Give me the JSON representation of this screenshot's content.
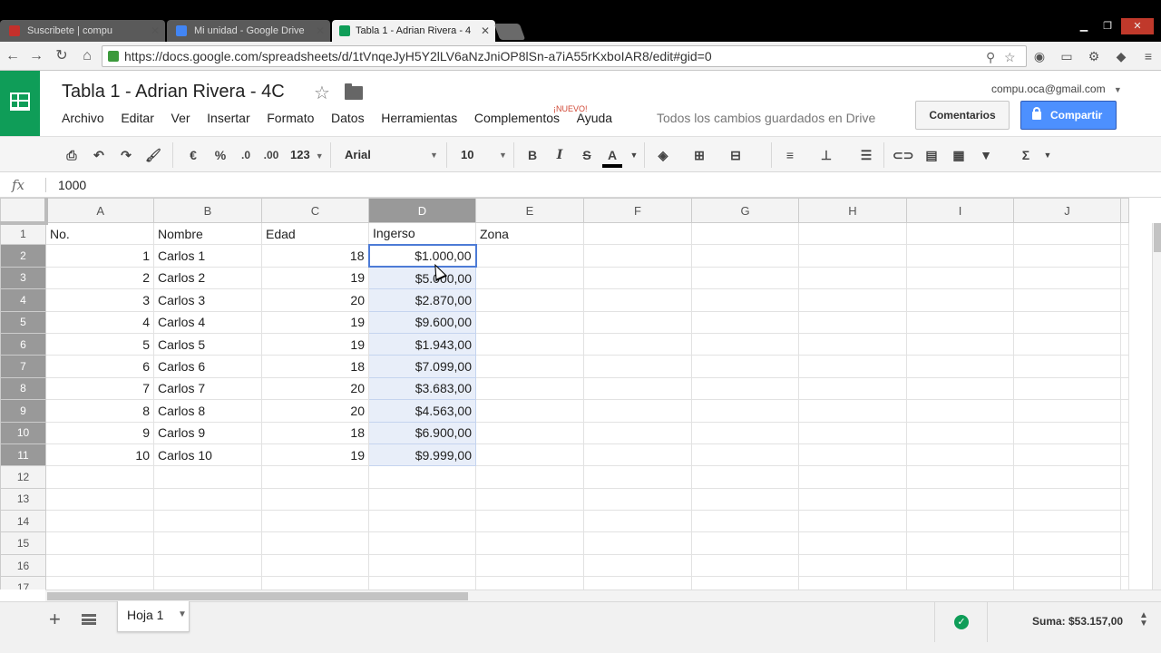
{
  "browser": {
    "tabs": [
      {
        "title": "Suscribete | compu",
        "active": false,
        "favicon_color": "#c4302b"
      },
      {
        "title": "Mi unidad - Google Drive",
        "active": false,
        "favicon_color": "#4285f4"
      },
      {
        "title": "Tabla 1 - Adrian Rivera - 4",
        "active": true,
        "favicon_color": "#0f9d58"
      }
    ],
    "url": "https://docs.google.com/spreadsheets/d/1tVnqeJyH5Y2lLV6aNzJniOP8lSn-a7iA55rKxboIAR8/edit#gid=0",
    "window_controls": [
      "minimize",
      "maximize",
      "close"
    ]
  },
  "doc": {
    "title": "Tabla 1 - Adrian Rivera - 4C",
    "menu": [
      "Archivo",
      "Editar",
      "Ver",
      "Insertar",
      "Formato",
      "Datos",
      "Herramientas",
      "Complementos",
      "Ayuda"
    ],
    "new_badge": "¡NUEVO!",
    "save_status": "Todos los cambios guardados en Drive",
    "account": "compu.oca@gmail.com",
    "comments_label": "Comentarios",
    "share_label": "Compartir"
  },
  "toolbar": {
    "currency": "€",
    "percent": "%",
    "dec_less": ".0",
    "dec_more": ".00",
    "format_more": "123",
    "font": "Arial",
    "font_size": "10",
    "bold": "B",
    "italic": "I",
    "strike": "S",
    "text_color": "A",
    "sum_symbol": "Σ"
  },
  "formula_bar": {
    "fx_label": "fx",
    "value": "1000"
  },
  "sheet": {
    "columns": [
      "A",
      "B",
      "C",
      "D",
      "E",
      "F",
      "G",
      "H",
      "I",
      "J"
    ],
    "selected_column": "D",
    "row_numbers": [
      "1",
      "2",
      "3",
      "4",
      "5",
      "6",
      "7",
      "8",
      "9",
      "10",
      "11",
      "12",
      "13",
      "14",
      "15",
      "16",
      "17"
    ],
    "header_row": [
      "No.",
      "Nombre",
      "Edad",
      "Ingerso",
      "Zona"
    ],
    "rows": [
      [
        "1",
        "Carlos 1",
        "18",
        "$1.000,00"
      ],
      [
        "2",
        "Carlos 2",
        "19",
        "$5.000,00"
      ],
      [
        "3",
        "Carlos 3",
        "20",
        "$2.870,00"
      ],
      [
        "4",
        "Carlos 4",
        "19",
        "$9.600,00"
      ],
      [
        "5",
        "Carlos 5",
        "19",
        "$1.943,00"
      ],
      [
        "6",
        "Carlos 6",
        "18",
        "$7.099,00"
      ],
      [
        "7",
        "Carlos 7",
        "20",
        "$3.683,00"
      ],
      [
        "8",
        "Carlos 8",
        "20",
        "$4.563,00"
      ],
      [
        "9",
        "Carlos 9",
        "18",
        "$6.900,00"
      ],
      [
        "10",
        "Carlos 10",
        "19",
        "$9.999,00"
      ]
    ]
  },
  "footer": {
    "sheet_tab": "Hoja 1",
    "sum_label": "Suma: $53.157,00"
  }
}
